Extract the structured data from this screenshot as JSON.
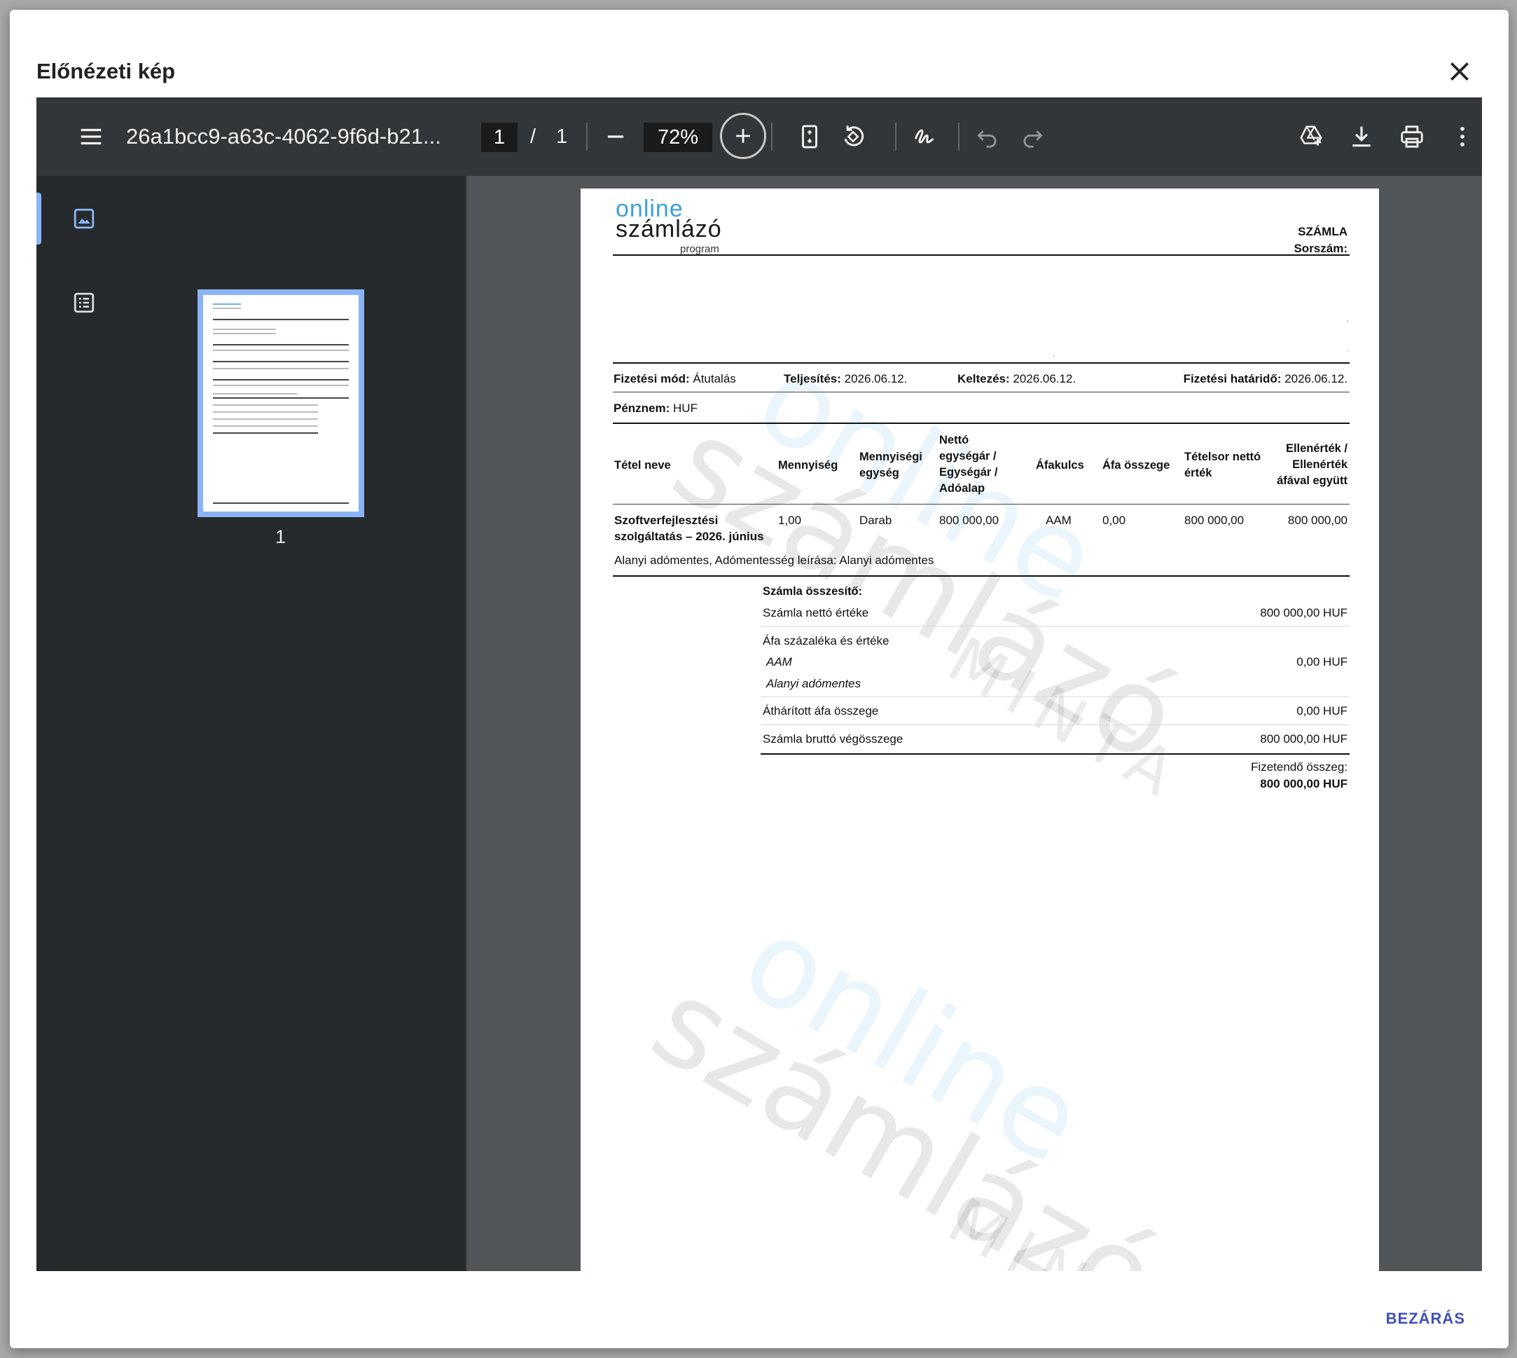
{
  "dialog": {
    "title": "Előnézeti kép",
    "close_label": "BEZÁRÁS"
  },
  "toolbar": {
    "file_name": "26a1bcc9-a63c-4062-9f6d-b21...",
    "page_current": "1",
    "page_separator": "/",
    "page_total": "1",
    "zoom": "72%"
  },
  "sidebar": {
    "thumbnail_page_number": "1"
  },
  "invoice": {
    "logo": {
      "line1": "online",
      "line2": "számlázó",
      "line3": "program"
    },
    "doc_type": "SZÁMLA",
    "serial_label": "Sorszám:",
    "payment_method_label": "Fizetési mód:",
    "payment_method": "Átutalás",
    "fulfillment_label": "Teljesítés:",
    "fulfillment_date": "2026.06.12.",
    "issue_label": "Keltezés:",
    "issue_date": "2026.06.12.",
    "due_label": "Fizetési határidő:",
    "due_date": "2026.06.12.",
    "currency_label": "Pénznem:",
    "currency": "HUF",
    "table_headers": {
      "item_name": "Tétel neve",
      "quantity": "Mennyiség",
      "unit": "Mennyiségi egység",
      "unit_price": "Nettó egységár / Egységár / Adóalap",
      "vat_rate": "Áfakulcs",
      "vat_amount": "Áfa összege",
      "net_total": "Tételsor nettó érték",
      "gross_total": "Ellenérték / Ellenérték áfával együtt"
    },
    "items": [
      {
        "name": "Szoftverfejlesztési szolgáltatás – 2026. június",
        "quantity": "1,00",
        "unit": "Darab",
        "unit_price": "800 000,00",
        "vat_rate": "AAM",
        "vat_amount": "0,00",
        "net_total": "800 000,00",
        "gross_total": "800 000,00"
      }
    ],
    "exemption_note": "Alanyi adómentes, Adómentesség leírása: Alanyi adómentes",
    "summary": {
      "title": "Számla összesítő:",
      "net_label": "Számla nettó értéke",
      "net_value": "800 000,00 HUF",
      "vat_section_label": "Áfa százaléka és értéke",
      "vat_code": "AAM",
      "vat_code_value": "0,00 HUF",
      "vat_code_desc": "Alanyi adómentes",
      "passed_vat_label": "Áthárított áfa összege",
      "passed_vat_value": "0,00 HUF",
      "gross_label": "Számla bruttó végösszege",
      "gross_value": "800 000,00 HUF",
      "payable_label": "Fizetendő összeg:",
      "payable_value": "800 000,00 HUF"
    },
    "watermark": {
      "word1": "online",
      "word2": "számlázó",
      "word3": "MINTA"
    }
  },
  "icons": {
    "menu": "menu-icon",
    "minus": "zoom-out-icon",
    "plus": "zoom-in-icon",
    "fit": "fit-page-icon",
    "rotate": "rotate-icon",
    "annotate": "annotate-icon",
    "undo": "undo-icon",
    "redo": "redo-icon",
    "drive": "add-to-drive-icon",
    "download": "download-icon",
    "print": "print-icon",
    "more": "more-vert-icon",
    "thumbnails": "thumbnails-icon",
    "outline": "outline-icon",
    "close": "close-icon"
  }
}
